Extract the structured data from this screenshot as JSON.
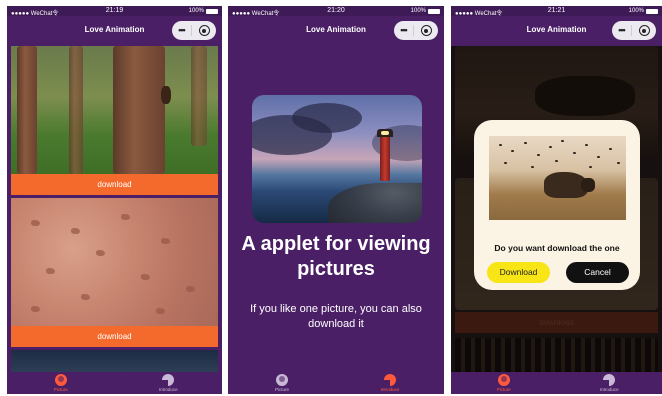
{
  "status_bar": {
    "carrier": "●●●●● WeChat令",
    "battery": "100%",
    "times": [
      "21:19",
      "21:20",
      "21:21"
    ]
  },
  "navbar": {
    "title": "Love Animation",
    "menu_icon": "more-dots-icon",
    "close_icon": "target-close-icon"
  },
  "screen1": {
    "download_label": "download"
  },
  "screen2": {
    "heading": "A applet for viewing pictures",
    "description": "If you like one picture, you can also download it"
  },
  "screen3": {
    "background_download_label": "download",
    "dialog": {
      "message": "Do you want download the one",
      "download_button": "Download",
      "cancel_button": "Cancel"
    }
  },
  "tabbar": {
    "tabs": [
      {
        "label": "Picture",
        "icon": "picture-icon"
      },
      {
        "label": "Introduce",
        "icon": "introduce-icon"
      }
    ]
  },
  "colors": {
    "primary_purple": "#4b1f66",
    "accent_orange": "#f46a2c",
    "dialog_yellow": "#f7e515",
    "dialog_black": "#111111"
  }
}
